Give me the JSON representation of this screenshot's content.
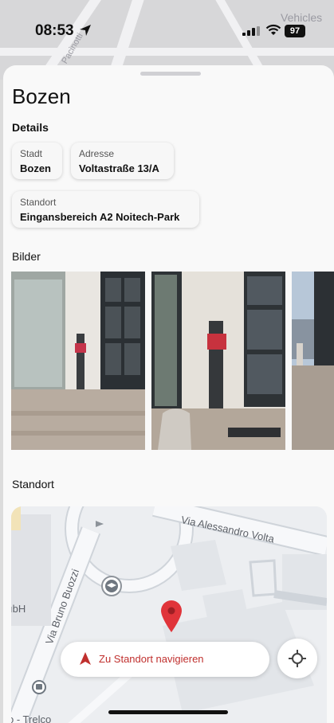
{
  "status_bar": {
    "time": "08:53",
    "battery": "97"
  },
  "background_map": {
    "street_top": "Pacinotti",
    "label_right": "Vehicles"
  },
  "header": {
    "title": "Bozen"
  },
  "details": {
    "heading": "Details",
    "city_label": "Stadt",
    "city_value": "Bozen",
    "address_label": "Adresse",
    "address_value": "Voltastraße 13/A",
    "location_label": "Standort",
    "location_value": "Eingansbereich A2 Noitech-Park"
  },
  "images": {
    "heading": "Bilder"
  },
  "location_map": {
    "heading": "Standort",
    "street_1": "Via Alessandro Volta",
    "street_2": "Via Bruno Buozzi",
    "label_left_top": "ıbH",
    "label_left_bottom": "o - Trelco"
  },
  "bottom": {
    "navigation_label": "Zu Standort navigieren"
  }
}
